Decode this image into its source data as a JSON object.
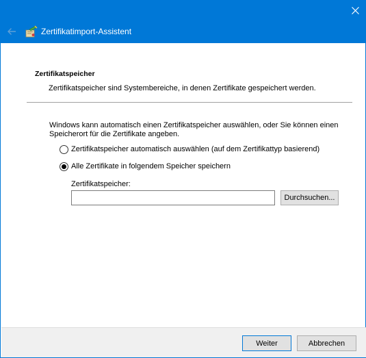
{
  "window": {
    "title": "Zertifikatimport-Assistent",
    "accent_color": "#0078d7"
  },
  "page": {
    "section_title": "Zertifikatspeicher",
    "section_description": "Zertifikatspeicher sind Systembereiche, in denen Zertifikate gespeichert werden.",
    "intro_text": "Windows kann automatisch einen Zertifikatspeicher auswählen, oder Sie können einen Speicherort für die Zertifikate angeben.",
    "options": [
      {
        "label": "Zertifikatspeicher automatisch auswählen (auf dem Zertifikattyp basierend)",
        "selected": false
      },
      {
        "label": "Alle Zertifikate in folgendem Speicher speichern",
        "selected": true
      }
    ],
    "store_field": {
      "label": "Zertifikatspeicher:",
      "value": "",
      "browse_label": "Durchsuchen..."
    }
  },
  "footer": {
    "next_label": "Weiter",
    "cancel_label": "Abbrechen"
  },
  "icons": {
    "close": "close-icon",
    "back": "back-arrow-icon",
    "wizard": "certificate-wizard-icon"
  }
}
